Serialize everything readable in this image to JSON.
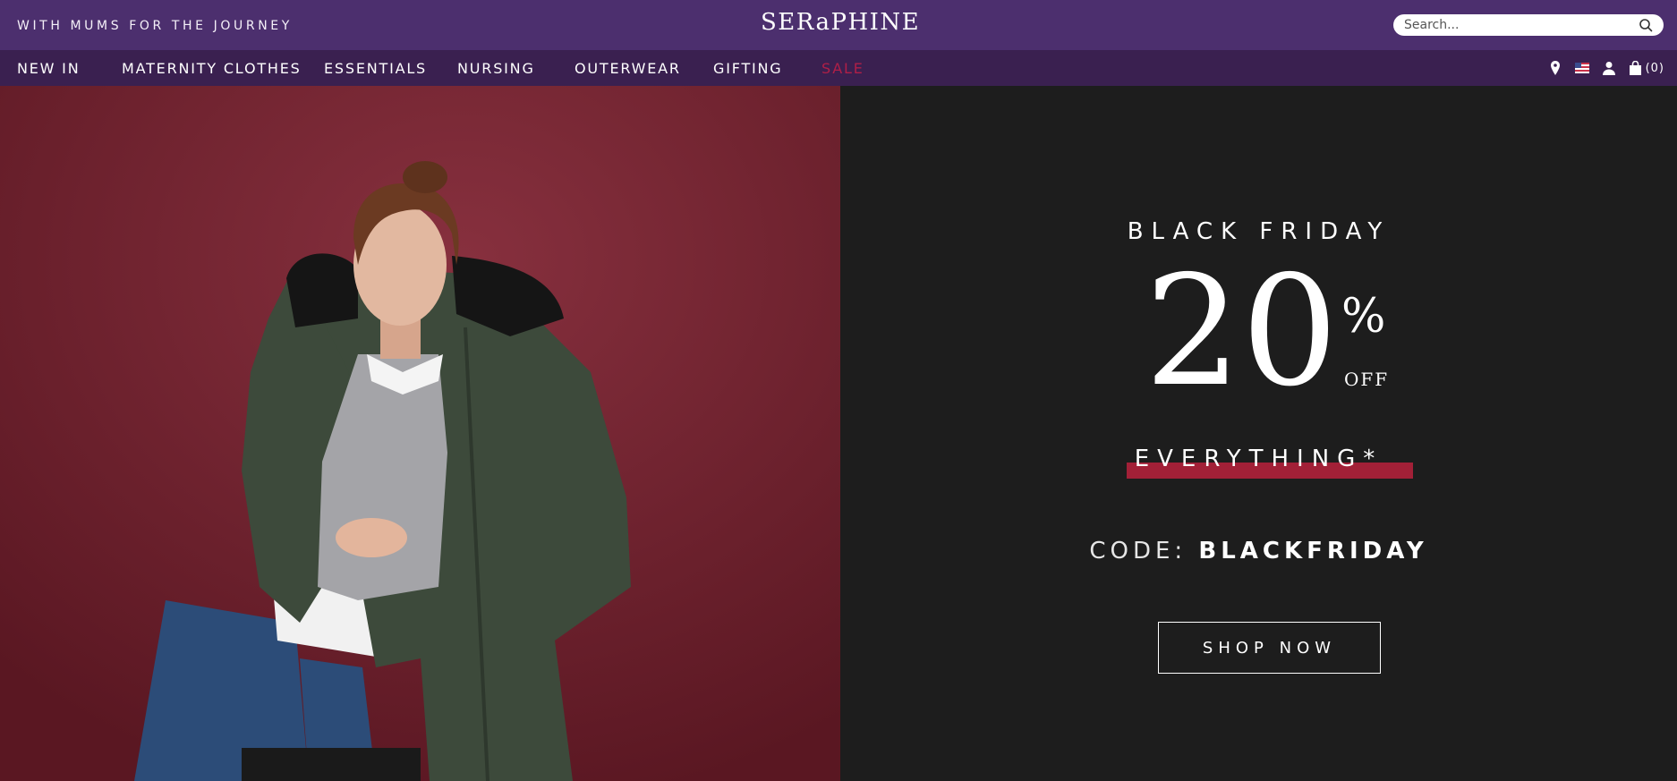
{
  "topbar": {
    "tagline": "WITH MUMS FOR THE JOURNEY",
    "logo": "SERaPHINE",
    "search_placeholder": "Search..."
  },
  "nav": {
    "items": [
      {
        "label": "NEW IN"
      },
      {
        "label": "MATERNITY CLOTHES"
      },
      {
        "label": "ESSENTIALS"
      },
      {
        "label": "NURSING"
      },
      {
        "label": "OUTERWEAR"
      },
      {
        "label": "GIFTING"
      },
      {
        "label": "SALE"
      }
    ],
    "bag_count": "(0)"
  },
  "hero": {
    "title": "BLACK FRIDAY",
    "discount_number": "20",
    "discount_symbol": "%",
    "discount_off": "OFF",
    "scope": "EVERYTHING*",
    "code_label": "CODE:",
    "code_value": "BLACKFRIDAY",
    "cta": "SHOP NOW"
  },
  "colors": {
    "topbar": "#4c2f6e",
    "nav": "#3a2050",
    "sale": "#b01f47",
    "hero_left": "#6b1f2b",
    "hero_right": "#1d1d1d",
    "accent_bar": "#a22037"
  }
}
